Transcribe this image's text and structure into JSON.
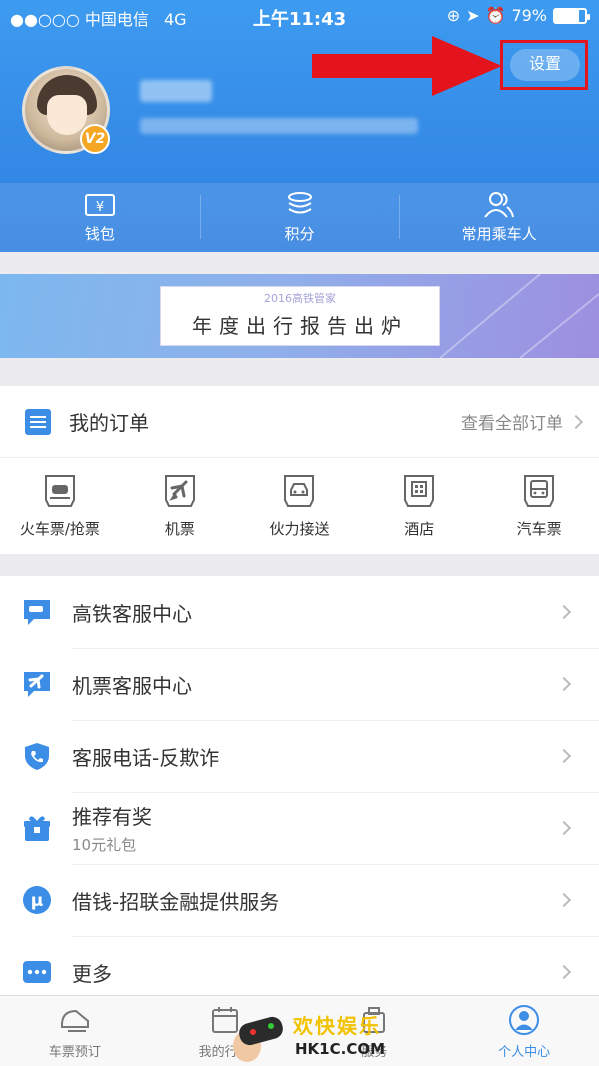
{
  "status_bar": {
    "carrier": "中国电信",
    "network": "4G",
    "time": "上午11:43",
    "battery": "79%"
  },
  "header": {
    "settings_label": "设置",
    "vip_level": "V2"
  },
  "quick_bar": [
    {
      "label": "钱包",
      "icon": "wallet-icon"
    },
    {
      "label": "积分",
      "icon": "points-icon"
    },
    {
      "label": "常用乘车人",
      "icon": "passengers-icon"
    }
  ],
  "banner": {
    "subtitle": "2016高铁管家",
    "title": "年度出行报告出炉"
  },
  "orders": {
    "title": "我的订单",
    "view_all": "查看全部订单",
    "categories": [
      {
        "label": "火车票/抢票",
        "icon": "train-icon"
      },
      {
        "label": "机票",
        "icon": "plane-icon"
      },
      {
        "label": "伙力接送",
        "icon": "car-icon"
      },
      {
        "label": "酒店",
        "icon": "hotel-icon"
      },
      {
        "label": "汽车票",
        "icon": "bus-icon"
      }
    ]
  },
  "services": [
    {
      "label": "高铁客服中心",
      "sub": "",
      "icon": "train-service-icon"
    },
    {
      "label": "机票客服中心",
      "sub": "",
      "icon": "plane-service-icon"
    },
    {
      "label": "客服电话-反欺诈",
      "sub": "",
      "icon": "phone-shield-icon"
    },
    {
      "label": "推荐有奖",
      "sub": "10元礼包",
      "icon": "gift-icon"
    },
    {
      "label": "借钱-招联金融提供服务",
      "sub": "",
      "icon": "loan-icon"
    },
    {
      "label": "更多",
      "sub": "",
      "icon": "more-icon"
    }
  ],
  "tab_bar": [
    {
      "label": "车票预订",
      "icon": "train-ticket-icon",
      "active": false
    },
    {
      "label": "我的行程",
      "icon": "calendar-icon",
      "active": false
    },
    {
      "label": "服务",
      "icon": "service-icon",
      "active": false
    },
    {
      "label": "个人中心",
      "icon": "user-icon",
      "active": true
    }
  ],
  "watermark": {
    "text1": "欢快娱乐",
    "text2": "HK1C.COM"
  },
  "colors": {
    "primary": "#3b8de6",
    "highlight": "#e3141c"
  }
}
